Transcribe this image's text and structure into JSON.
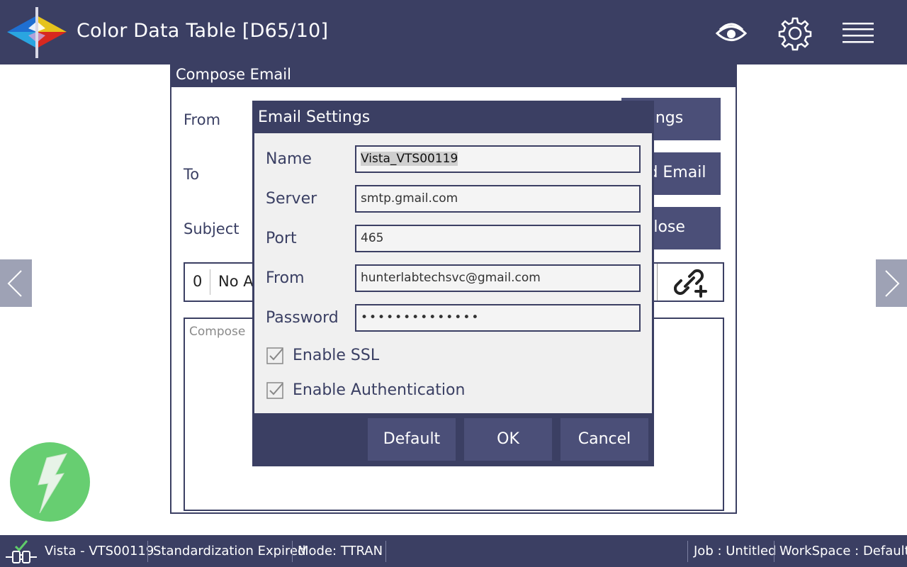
{
  "header": {
    "title": "Color Data Table [D65/10]",
    "icons": [
      "eye-icon",
      "gear-icon",
      "hamburger-menu-icon"
    ]
  },
  "compose": {
    "title": "Compose Email",
    "from_label": "From",
    "to_label": "To",
    "subject_label": "Subject",
    "settings_button": "Settings",
    "send_button": "Send Email",
    "close_button": "Close",
    "attachment_count": "0",
    "attachment_text": "No A",
    "body_placeholder": "Compose"
  },
  "email_settings": {
    "title": "Email Settings",
    "name_label": "Name",
    "name_value": "Vista_VTS00119",
    "server_label": "Server",
    "server_value": "smtp.gmail.com",
    "port_label": "Port",
    "port_value": "465",
    "from_label": "From",
    "from_value": "hunterlabtechsvc@gmail.com",
    "password_label": "Password",
    "password_value": "••••••••••••••",
    "enable_ssl_label": "Enable SSL",
    "enable_ssl_checked": true,
    "enable_auth_label": "Enable Authentication",
    "enable_auth_checked": true,
    "default_button": "Default",
    "ok_button": "OK",
    "cancel_button": "Cancel"
  },
  "statusbar": {
    "device": "Vista - VTS00119",
    "standardization": "Standardization Expired",
    "mode": "Mode:  TTRAN",
    "job": "Job :  Untitled",
    "workspace": "WorkSpace :  Default"
  },
  "colors": {
    "primary": "#3b3f63",
    "button": "#4b4f78",
    "flash_green": "#5fcc6a",
    "nav_arrow": "#9ea2b5"
  }
}
